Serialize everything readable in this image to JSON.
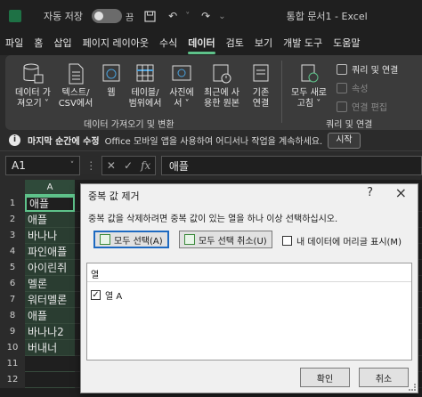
{
  "titlebar": {
    "autosave_label": "자동 저장",
    "autosave_state": "끔",
    "doc_title": "통합 문서1 - Excel"
  },
  "ribbon_tabs": [
    "파일",
    "홈",
    "삽입",
    "페이지 레이아웃",
    "수식",
    "데이터",
    "검토",
    "보기",
    "개발 도구",
    "도움말"
  ],
  "active_tab": "데이터",
  "ribbon": {
    "get_data": "데이터 가\n져오기 ˅",
    "text_csv": "텍스트/\nCSV에서",
    "web": "웹",
    "table_range": "테이블/\n범위에서",
    "from_picture": "사진에\n서 ˅",
    "recent_sources": "최근에 사\n용한 원본",
    "existing_conn": "기존\n연결",
    "group1_label": "데이터 가져오기 및 변환",
    "refresh_all": "모두 새로\n고침 ˅",
    "queries_conn": "쿼리 및 연결",
    "properties": "속성",
    "edit_links": "연결 편집",
    "group2_label": "쿼리 및 연결"
  },
  "infobar": {
    "bold": "마지막 순간에 수정",
    "text": "Office 모바일 앱을 사용하여 어디서나 작업을 계속하세요.",
    "button": "시작"
  },
  "formulabar": {
    "name_box": "A1",
    "value": "애플"
  },
  "grid": {
    "column_header": "A",
    "rows": [
      {
        "num": "1",
        "value": "애플"
      },
      {
        "num": "2",
        "value": "애플"
      },
      {
        "num": "3",
        "value": "바나나"
      },
      {
        "num": "4",
        "value": "파인애플"
      },
      {
        "num": "5",
        "value": "아이린쥐"
      },
      {
        "num": "6",
        "value": "멜론"
      },
      {
        "num": "7",
        "value": "워터멜론"
      },
      {
        "num": "8",
        "value": "애플"
      },
      {
        "num": "9",
        "value": "바나나2"
      },
      {
        "num": "10",
        "value": "버내너"
      },
      {
        "num": "11",
        "value": ""
      },
      {
        "num": "12",
        "value": ""
      }
    ]
  },
  "dialog": {
    "title": "중복 값 제거",
    "help": "?",
    "close": "×",
    "instruction": "중복 값을 삭제하려면 중복 값이 있는 열을 하나 이상 선택하십시오.",
    "select_all": "모두 선택(A)",
    "unselect_all": "모두 선택 취소(U)",
    "header_checkbox": "내 데이터에 머리글 표시(M)",
    "list_header": "열",
    "list_items": [
      "열 A"
    ],
    "ok": "확인",
    "cancel": "취소"
  }
}
